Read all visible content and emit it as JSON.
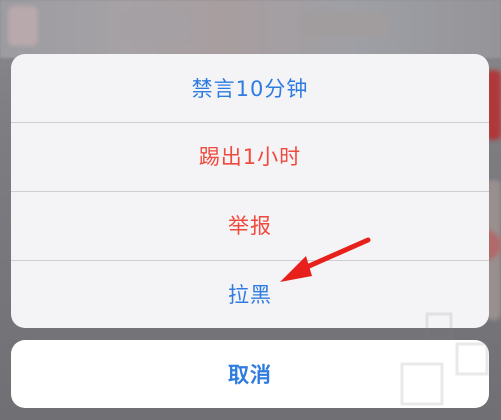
{
  "colors": {
    "action_blue": "#2f7ce0",
    "destructive_red": "#f04a3f",
    "annotation_red": "#e8201c"
  },
  "action_sheet": {
    "items": [
      {
        "label": "禁言10分钟",
        "style": "default"
      },
      {
        "label": "踢出1小时",
        "style": "destructive"
      },
      {
        "label": "举报",
        "style": "destructive"
      },
      {
        "label": "拉黑",
        "style": "default"
      }
    ],
    "cancel_label": "取消"
  },
  "annotation": {
    "icon": "red-arrow-icon",
    "points_to": "拉黑"
  }
}
